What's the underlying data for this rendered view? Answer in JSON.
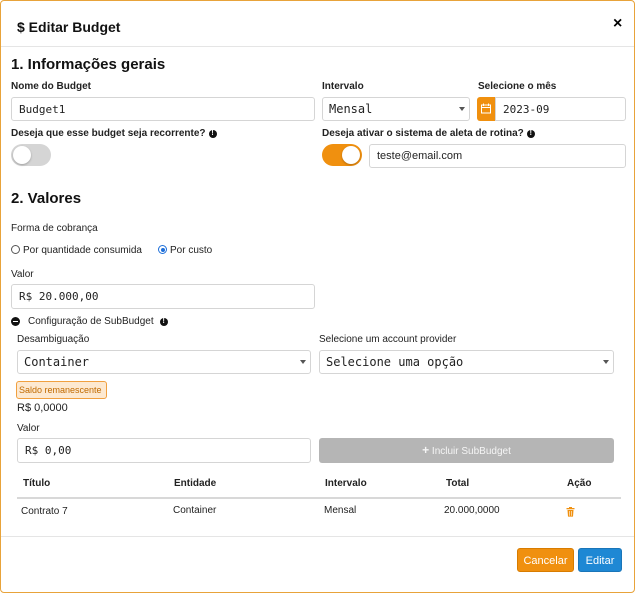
{
  "modal": {
    "title": "$ Editar Budget",
    "close": "×"
  },
  "general": {
    "heading": "1. Informações gerais",
    "name_label": "Nome do Budget",
    "name_value": "Budget1",
    "interval_label": "Intervalo",
    "interval_value": "Mensal",
    "month_label": "Selecione o mês",
    "month_value": "2023-09",
    "recurring_label": "Deseja que esse budget seja recorrente?",
    "recurring_on": false,
    "alert_label": "Deseja ativar o sistema de aleta de rotina?",
    "alert_on": true,
    "email_value": "teste@email.com"
  },
  "values": {
    "heading": "2. Valores",
    "billing_label": "Forma de cobrança",
    "option_quantity": "Por quantidade consumida",
    "option_cost": "Por custo",
    "selected_option": "Por custo",
    "value_label": "Valor",
    "value_amount": "R$ 20.000,00"
  },
  "subbudget": {
    "toggle_label": "Configuração de SubBudget",
    "disambiguation_label": "Desambiguação",
    "disambiguation_value": "Container",
    "provider_label": "Selecione um account provider",
    "provider_value": "Selecione uma opção",
    "remaining_label": "Saldo remanescente",
    "remaining_value": "R$ 0,0000",
    "value_label": "Valor",
    "value_amount": "R$ 0,00",
    "include_button": "Incluir SubBudget",
    "table": {
      "headers": [
        "Título",
        "Entidade",
        "Intervalo",
        "Total",
        "Ação"
      ],
      "rows": [
        {
          "title": "Contrato 7",
          "entity": "Container",
          "interval": "Mensal",
          "total": "20.000,0000"
        }
      ]
    }
  },
  "footer": {
    "cancel": "Cancelar",
    "submit": "Editar"
  },
  "colors": {
    "accent": "#f0900f",
    "primary": "#1e88d4",
    "disabled": "#b5b5b5",
    "warning_bg": "#fde9d1"
  }
}
